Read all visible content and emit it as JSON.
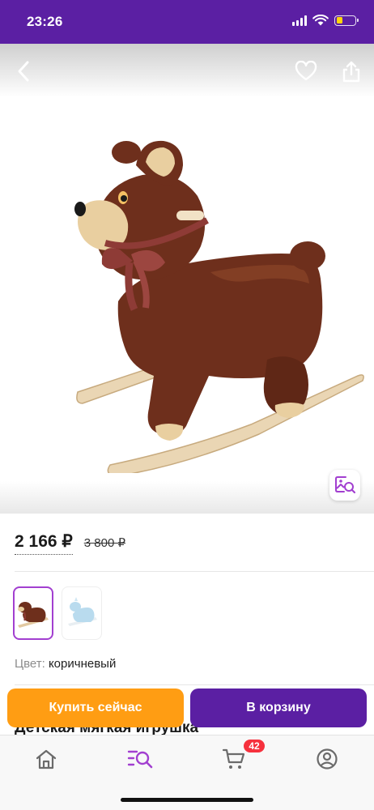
{
  "status_bar": {
    "time": "23:26",
    "battery_level": 0.35,
    "battery_color": "#ffd60a"
  },
  "header": {
    "back_icon": "chevron-left-icon",
    "favorite_icon": "heart-icon",
    "share_icon": "share-icon"
  },
  "gallery": {
    "main_image": "brown plush rocking bear on wooden rockers",
    "visual_search_icon": "image-search-icon",
    "thumbnails": [
      {
        "image": "brown rocking bear",
        "selected": true
      },
      {
        "image": "light blue rocking toy",
        "selected": false
      }
    ]
  },
  "price": {
    "current": "2 166 ₽",
    "old": "3 800 ₽"
  },
  "color": {
    "label": "Цвет:",
    "value": "коричневый"
  },
  "product": {
    "title": "Детская мягкая игрушка"
  },
  "actions": {
    "buy_now": "Купить сейчас",
    "add_to_cart": "В корзину"
  },
  "tab_bar": {
    "items": [
      {
        "name": "home",
        "icon": "home-icon"
      },
      {
        "name": "catalog",
        "icon": "catalog-search-icon",
        "active": true
      },
      {
        "name": "cart",
        "icon": "cart-icon",
        "badge": "42"
      },
      {
        "name": "profile",
        "icon": "profile-icon"
      }
    ]
  },
  "colors": {
    "brand_purple": "#5b1fa3",
    "buy_orange": "#ff9d13",
    "badge_red": "#f6313d",
    "active_tab": "#a23fd0"
  }
}
